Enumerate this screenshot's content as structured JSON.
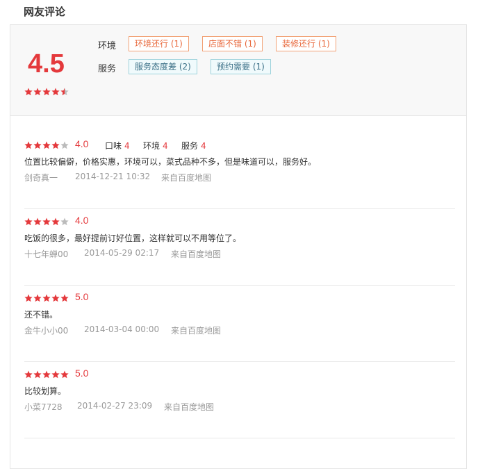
{
  "section_title": "网友评论",
  "summary": {
    "score": "4.5",
    "stars": 4.5,
    "tag_groups": [
      {
        "category": "环境",
        "tags": [
          {
            "label": "环境还行 (1)",
            "tone": "positive"
          },
          {
            "label": "店面不错 (1)",
            "tone": "positive"
          },
          {
            "label": "装修还行 (1)",
            "tone": "positive"
          }
        ]
      },
      {
        "category": "服务",
        "tags": [
          {
            "label": "服务态度差 (2)",
            "tone": "negative"
          },
          {
            "label": "预约需要 (1)",
            "tone": "negative"
          }
        ]
      }
    ]
  },
  "reviews": [
    {
      "stars": 4,
      "score": "4.0",
      "subscores": [
        {
          "label": "口味",
          "value": "4"
        },
        {
          "label": "环境",
          "value": "4"
        },
        {
          "label": "服务",
          "value": "4"
        }
      ],
      "text": "位置比较偏僻，价格实惠，环境可以，菜式品种不多，但是味道可以，服务好。",
      "user": "剑奇真一",
      "time": "2014-12-21 10:32",
      "source": "来自百度地图"
    },
    {
      "stars": 4,
      "score": "4.0",
      "subscores": [],
      "text": "吃饭的很多，最好提前订好位置，这样就可以不用等位了。",
      "user": "十七年蝉00",
      "time": "2014-05-29 02:17",
      "source": "来自百度地图"
    },
    {
      "stars": 5,
      "score": "5.0",
      "subscores": [],
      "text": "还不错。",
      "user": "金牛小小00",
      "time": "2014-03-04 00:00",
      "source": "来自百度地图"
    },
    {
      "stars": 5,
      "score": "5.0",
      "subscores": [],
      "text": "比较划算。",
      "user": "小菜7728",
      "time": "2014-02-27 23:09",
      "source": "来自百度地图"
    }
  ],
  "colors": {
    "accent": "#e4393c",
    "star_on": "#e4393c",
    "star_off": "#bbbbbb",
    "tag_positive": "#e8673a",
    "tag_negative": "#3a6f86"
  }
}
